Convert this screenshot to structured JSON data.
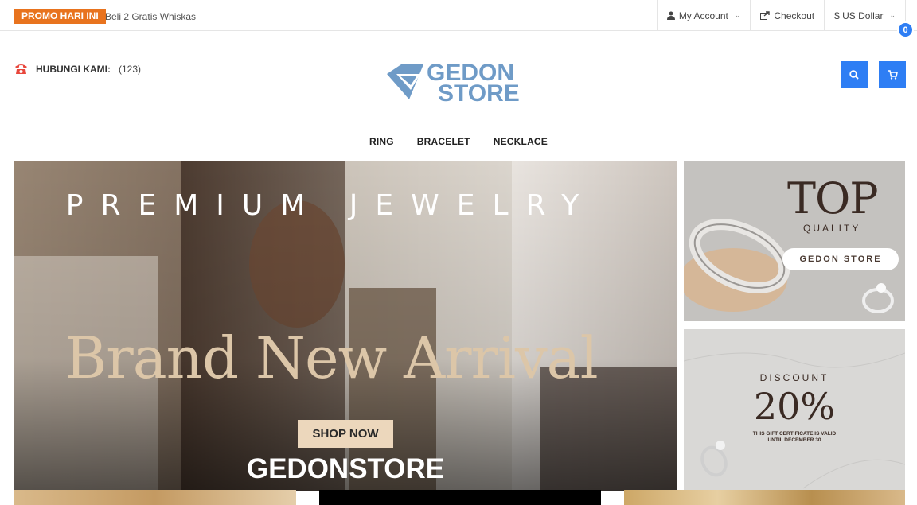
{
  "topbar": {
    "promo_badge": "PROMO HARI INI",
    "promo_text": "Beli 2 Gratis Whiskas",
    "my_account": "My Account",
    "checkout": "Checkout",
    "currency": "$ US Dollar"
  },
  "header": {
    "contact_label": "HUBUNGI KAMI:",
    "contact_number": "(123)",
    "logo_line1": "GEDON",
    "logo_line2": "STORE",
    "cart_count": "0"
  },
  "nav": {
    "items": [
      "RING",
      "BRACELET",
      "NECKLACE"
    ]
  },
  "hero": {
    "title": "PREMIUM JEWELRY",
    "subtitle": "Brand New Arrival",
    "cta": "SHOP NOW",
    "store_name": "GEDONSTORE"
  },
  "side_banner_top": {
    "big": "TOP",
    "quality": "QUALITY",
    "pill": "GEDON STORE"
  },
  "side_banner_bottom": {
    "label": "DISCOUNT",
    "value": "20%",
    "note_line1": "THIS GIFT CERTIFICATE IS VALID",
    "note_line2": "UNTIL DECEMBER 30"
  },
  "colors": {
    "accent": "#2e7ef4",
    "promo": "#e8731e",
    "phone_icon": "#e8473c",
    "logo": "#6f9bc7"
  }
}
